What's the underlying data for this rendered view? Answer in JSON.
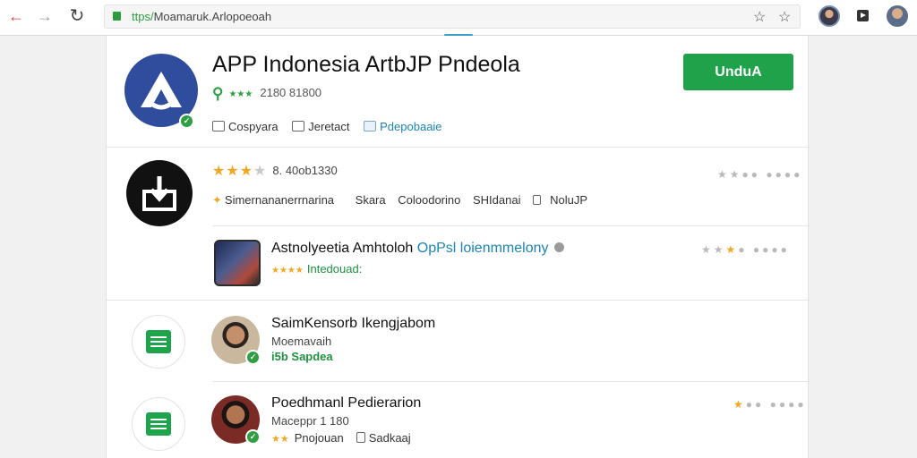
{
  "browser": {
    "url_scheme": "ttps/",
    "url_rest": "Moamaruk.Arlopoeoah",
    "back_icon": "arrow-left-icon",
    "forward_icon": "arrow-right-icon",
    "reload_icon": "reload-icon"
  },
  "app": {
    "title": "APP Indonesia ArtbJP Pndeola",
    "meta": "2180 81800",
    "install_label": "UnduA",
    "tags": [
      "Cospyara",
      "Jeretact",
      "Pdepobaaie"
    ]
  },
  "rows": [
    {
      "rating_text": "8. 40ob1330",
      "categories": [
        "Simernananerrnarina",
        "Skara",
        "Coloodorino",
        "SHIdanai",
        "NoluJP"
      ]
    },
    {
      "title": "Astnolyeetia Amhtoloh",
      "title_link": "OpPsl loienmmelony",
      "subtitle": "Intedouad:"
    },
    {
      "title": "SaimKensorb Ikengjabom",
      "subtitle": "Moemavaih",
      "green_text": "i5b Sapdea"
    },
    {
      "title": "Poedhmanl Pedierarion",
      "subtitle": "Maceppr 1 180",
      "meta_a": "Pnojouan",
      "meta_b": "Sadkaaj"
    }
  ],
  "colors": {
    "install_green": "#1fa24a",
    "star_orange": "#f2a722",
    "link_blue": "#1c84b3",
    "app_icon_blue": "#2f4d9c"
  }
}
